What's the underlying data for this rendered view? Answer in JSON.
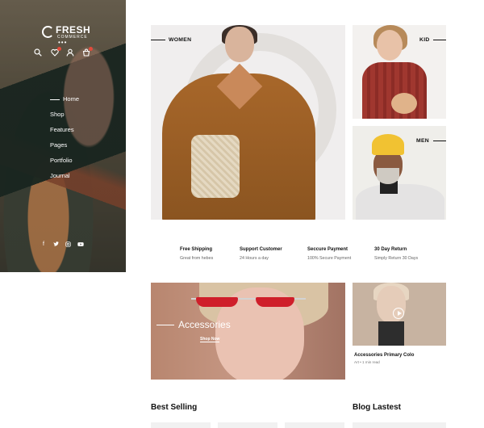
{
  "sidebar": {
    "logo": {
      "name": "FRESH",
      "tagline": "COMMERCE"
    },
    "icons": [
      "search-icon",
      "wishlist-icon",
      "user-icon",
      "cart-icon"
    ],
    "menu": [
      {
        "label": "Home",
        "active": true
      },
      {
        "label": "Shop",
        "active": false
      },
      {
        "label": "Features",
        "active": false
      },
      {
        "label": "Pages",
        "active": false
      },
      {
        "label": "Portfolio",
        "active": false
      },
      {
        "label": "Journal",
        "active": false
      }
    ],
    "social": [
      "facebook-icon",
      "twitter-icon",
      "instagram-icon",
      "youtube-icon"
    ],
    "colors": {
      "badge": "#e24a3b"
    }
  },
  "categories": {
    "women": "WOMEN",
    "kid": "KID",
    "men": "MEN"
  },
  "features": [
    {
      "title": "Free Shipping",
      "desc": "Great from hebes"
    },
    {
      "title": "Support Customer",
      "desc": "24 Hours a day"
    },
    {
      "title": "Seccure Payment",
      "desc": "100% Secure Payment"
    },
    {
      "title": "30 Day Return",
      "desc": "Simply Return 30 Days"
    }
  ],
  "promo": {
    "title": "Accessories",
    "button": "Shop Now"
  },
  "blog_post": {
    "title": "Accessories Primary Colo",
    "meta": "Art • 1 min read"
  },
  "sections": {
    "best_selling": "Best Selling",
    "blog": "Blog Lastest"
  }
}
